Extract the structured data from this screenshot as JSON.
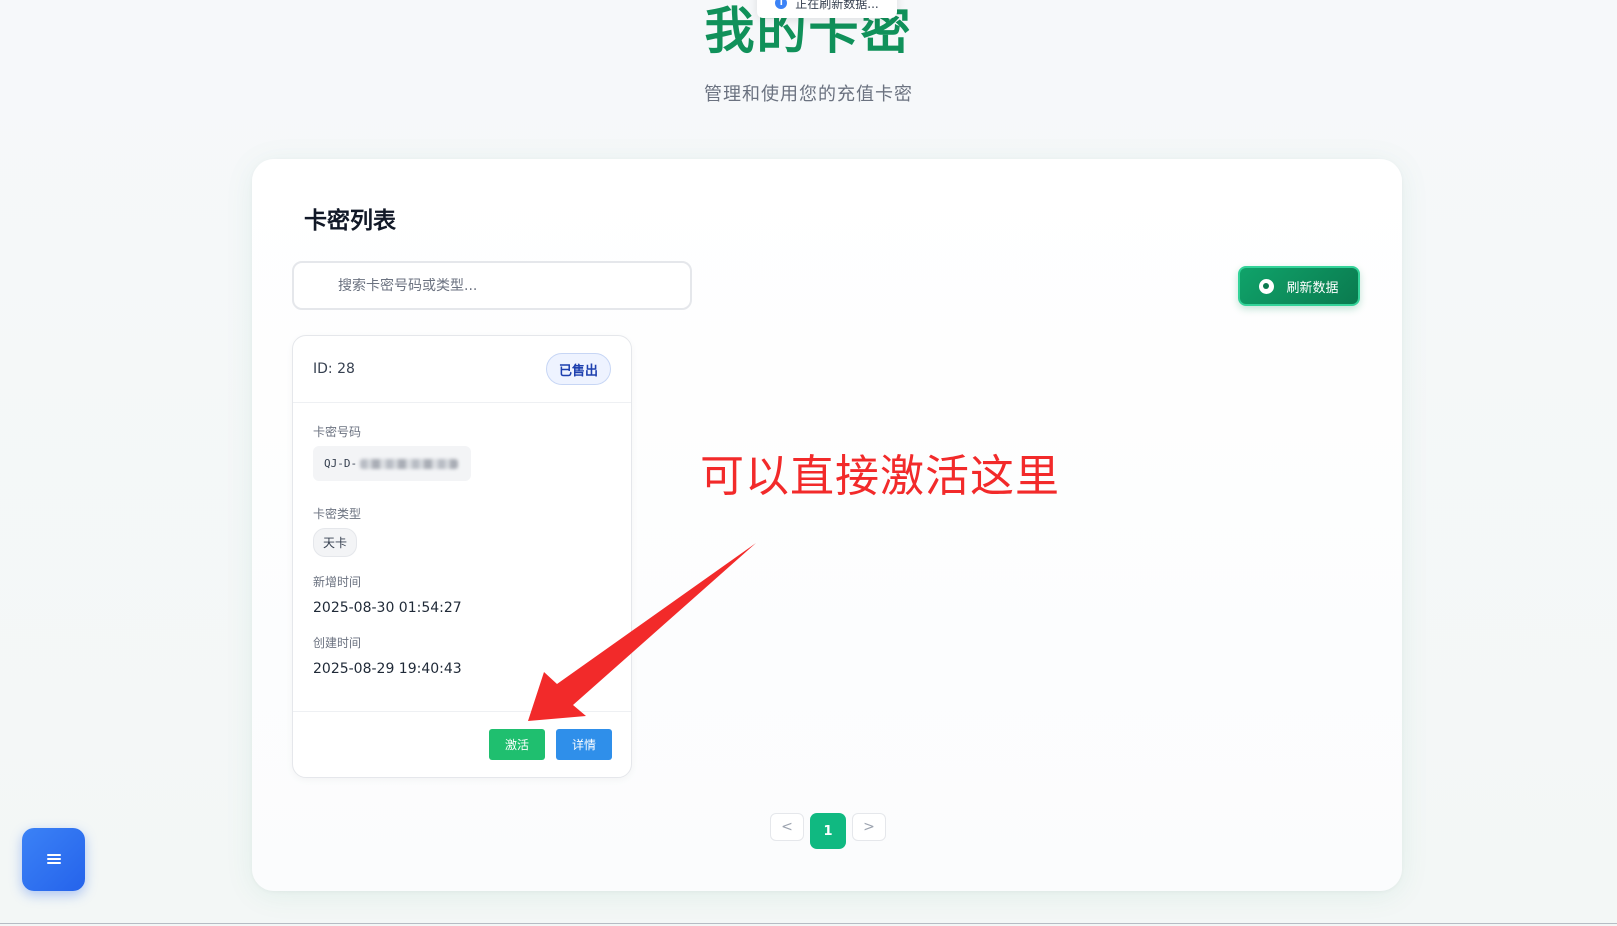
{
  "toast": {
    "text": "正在刷新数据..."
  },
  "header": {
    "title": "我的卡密",
    "subtitle": "管理和使用您的充值卡密"
  },
  "panel": {
    "title": "卡密列表",
    "search": {
      "placeholder": "搜索卡密号码或类型...",
      "value": ""
    },
    "refresh_label": "刷新数据"
  },
  "card": {
    "id_text": "ID: 28",
    "status": "已售出",
    "code_label": "卡密号码",
    "code_prefix": "QJ-D-",
    "type_label": "卡密类型",
    "type_value": "天卡",
    "updated_label": "新增时间",
    "updated_value": "2025-08-30 01:54:27",
    "created_label": "创建时间",
    "created_value": "2025-08-29 19:40:43",
    "activate_label": "激活",
    "detail_label": "详情"
  },
  "pagination": {
    "prev": "<",
    "current": "1",
    "next": ">"
  },
  "annotation": {
    "text": "可以直接激活这里",
    "color": "#f22a2a"
  },
  "colors": {
    "brand_green": "#10915a",
    "activate": "#1fbf6f",
    "detail": "#2f8fea",
    "page_active": "#10b981"
  },
  "icons": {
    "fab": "menu-icon",
    "refresh": "refresh-icon",
    "toast": "info-icon"
  }
}
